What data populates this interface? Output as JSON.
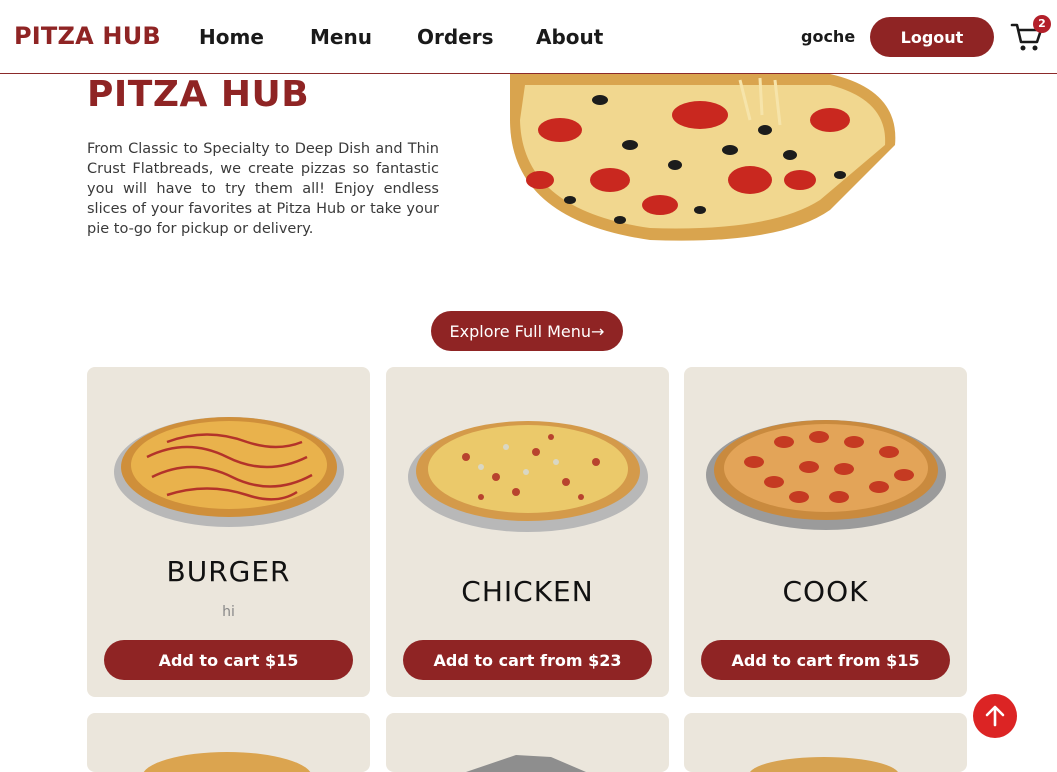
{
  "header": {
    "brand": "PITZA HUB",
    "nav": [
      "Home",
      "Menu",
      "Orders",
      "About"
    ],
    "username": "goche",
    "logout_label": "Logout",
    "cart_count": "2"
  },
  "hero": {
    "title": "PITZA HUB",
    "text": "From Classic to Specialty to Deep Dish and Thin Crust Flatbreads, we create pizzas so fantastic you will have to try them all! Enjoy endless slices of your favorites at Pitza Hub or take your pie to-go for pickup or delivery."
  },
  "explore_label": "Explore Full Menu→",
  "products": [
    {
      "name": "BURGER",
      "description": "hi",
      "button": "Add to cart $15"
    },
    {
      "name": "CHICKEN",
      "description": "",
      "button": "Add to cart from $23"
    },
    {
      "name": "COOK",
      "description": "",
      "button": "Add to cart from $15"
    }
  ],
  "colors": {
    "brand": "#8f2424",
    "card_bg": "#ebe6dc",
    "scroll_top": "#dc2424"
  },
  "icons": {
    "cart": "shopping-cart-icon",
    "scroll_top": "arrow-up-icon"
  }
}
